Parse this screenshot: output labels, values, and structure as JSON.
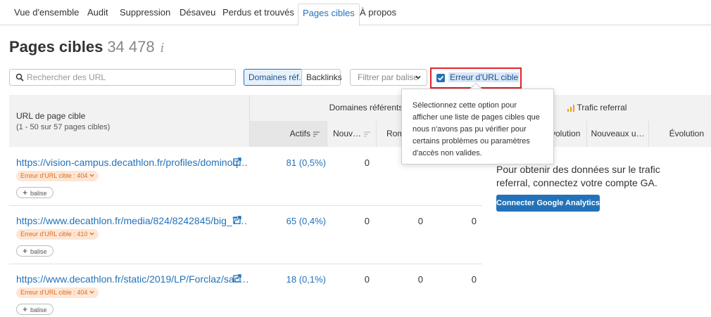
{
  "tabs": [
    {
      "label": "Vue d'ensemble"
    },
    {
      "label": "Audit"
    },
    {
      "label": "Suppression"
    },
    {
      "label": "Désaveu"
    },
    {
      "label": "Perdus et trouvés"
    },
    {
      "label": "Pages cibles",
      "active": true
    },
    {
      "label": "À propos"
    }
  ],
  "page": {
    "title": "Pages cibles",
    "count": "34 478",
    "info_glyph": "i"
  },
  "controls": {
    "search_placeholder": "Rechercher des URL",
    "segment_left": "Domaines réf.",
    "segment_right": "Backlinks",
    "filter_label": "Filtrer par balise",
    "checkbox_label": "Erreur d'URL cible",
    "checkbox_checked": true
  },
  "table": {
    "url_header": "URL de page cible",
    "url_subheader": "(1 - 50 sur 57 pages cibles)",
    "group_domains": "Domaines référents",
    "group_traffic": "Trafic referral",
    "columns": {
      "actifs": "Actifs",
      "nouveaux": "Nouv…",
      "rompus": "Rom",
      "evolution1": "Évolution",
      "nouveaux_u": "Nouveaux u…",
      "evolution2": "Évolution"
    },
    "tag_label": "balise",
    "rows": [
      {
        "url": "https://vision-campus.decathlon.fr/profiles/dominoq…",
        "error": "Erreur d'URL cible : 404",
        "actifs": "81 (0,5%)",
        "nouveaux": "0",
        "rompus": "0",
        "extra": ""
      },
      {
        "url": "https://www.decathlon.fr/media/824/8242845/big_7…",
        "error": "Erreur d'URL cible : 410",
        "actifs": "65 (0,4%)",
        "nouveaux": "0",
        "rompus": "0",
        "extra": "0"
      },
      {
        "url": "https://www.decathlon.fr/static/2019/LP/Forclaz/sac…",
        "error": "Erreur d'URL cible : 404",
        "actifs": "18 (0,1%)",
        "nouveaux": "0",
        "rompus": "0",
        "extra": "0"
      }
    ]
  },
  "ga": {
    "text": "Pour obtenir des données sur le trafic referral, connectez votre compte GA.",
    "button": "Connecter Google Analytics"
  },
  "tooltip": {
    "text": "Sélectionnez cette option pour afficher une liste de pages cibles que nous n'avons pas pu vérifier pour certains problèmes ou paramètres d'accès non valides."
  },
  "colors": {
    "accent": "#2372b9",
    "error_badge_bg": "#fde6d6",
    "error_badge_text": "#e06b16",
    "highlight_border": "#e0242a",
    "traffic_icon": "#f39c12"
  }
}
